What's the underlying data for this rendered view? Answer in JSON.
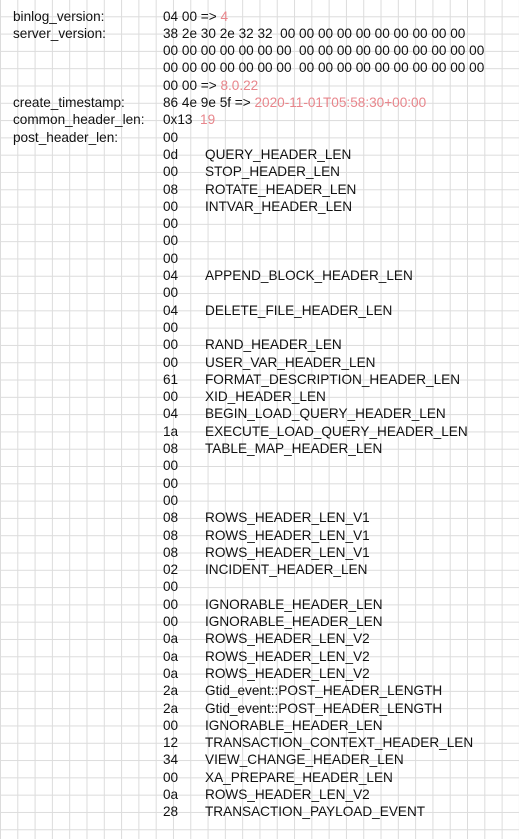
{
  "header_fields": [
    {
      "label": "binlog_version:",
      "parts": [
        {
          "text": "04 00 => "
        },
        {
          "text": "4",
          "highlight": true
        }
      ]
    },
    {
      "label": "server_version:",
      "parts": [
        {
          "text": "38 2e 30 2e 32 32  00 00 00 00 00 00 00 00 00 00"
        }
      ]
    },
    {
      "label": "",
      "parts": [
        {
          "text": "00 00 00 00 00 00 00  00 00 00 00 00 00 00 00 00 00"
        }
      ]
    },
    {
      "label": "",
      "parts": [
        {
          "text": "00 00 00 00 00 00 00  00 00 00 00 00 00 00 00 00 00"
        }
      ]
    },
    {
      "label": "",
      "parts": [
        {
          "text": "00 00 => "
        },
        {
          "text": "8.0.22",
          "highlight": true
        }
      ]
    },
    {
      "label": "create_timestamp:",
      "parts": [
        {
          "text": "86 4e 9e 5f => "
        },
        {
          "text": "2020-11-01T05:58:30+00:00",
          "highlight": true
        }
      ]
    },
    {
      "label": "common_header_len:",
      "parts": [
        {
          "text": "0x13  "
        },
        {
          "text": "19",
          "highlight": true
        }
      ]
    },
    {
      "label": "post_header_len:",
      "parts": [
        {
          "text": "00"
        }
      ]
    }
  ],
  "post_header_entries": [
    {
      "hex": "0d",
      "name": "QUERY_HEADER_LEN"
    },
    {
      "hex": "00",
      "name": "STOP_HEADER_LEN"
    },
    {
      "hex": "08",
      "name": "ROTATE_HEADER_LEN"
    },
    {
      "hex": "00",
      "name": "INTVAR_HEADER_LEN"
    },
    {
      "hex": "00",
      "name": ""
    },
    {
      "hex": "00",
      "name": ""
    },
    {
      "hex": "00",
      "name": ""
    },
    {
      "hex": "04",
      "name": "APPEND_BLOCK_HEADER_LEN"
    },
    {
      "hex": "00",
      "name": ""
    },
    {
      "hex": "04",
      "name": "DELETE_FILE_HEADER_LEN"
    },
    {
      "hex": "00",
      "name": ""
    },
    {
      "hex": "00",
      "name": "RAND_HEADER_LEN"
    },
    {
      "hex": "00",
      "name": "USER_VAR_HEADER_LEN"
    },
    {
      "hex": "61",
      "name": "FORMAT_DESCRIPTION_HEADER_LEN"
    },
    {
      "hex": "00",
      "name": "XID_HEADER_LEN"
    },
    {
      "hex": "04",
      "name": "BEGIN_LOAD_QUERY_HEADER_LEN"
    },
    {
      "hex": "1a",
      "name": "EXECUTE_LOAD_QUERY_HEADER_LEN"
    },
    {
      "hex": "08",
      "name": "TABLE_MAP_HEADER_LEN"
    },
    {
      "hex": "00",
      "name": ""
    },
    {
      "hex": "00",
      "name": ""
    },
    {
      "hex": "00",
      "name": ""
    },
    {
      "hex": "08",
      "name": "ROWS_HEADER_LEN_V1"
    },
    {
      "hex": "08",
      "name": "ROWS_HEADER_LEN_V1"
    },
    {
      "hex": "08",
      "name": "ROWS_HEADER_LEN_V1"
    },
    {
      "hex": "02",
      "name": "INCIDENT_HEADER_LEN"
    },
    {
      "hex": "00",
      "name": ""
    },
    {
      "hex": "00",
      "name": "IGNORABLE_HEADER_LEN"
    },
    {
      "hex": "00",
      "name": "IGNORABLE_HEADER_LEN"
    },
    {
      "hex": "0a",
      "name": "ROWS_HEADER_LEN_V2"
    },
    {
      "hex": "0a",
      "name": "ROWS_HEADER_LEN_V2"
    },
    {
      "hex": "0a",
      "name": "ROWS_HEADER_LEN_V2"
    },
    {
      "hex": "2a",
      "name": "Gtid_event::POST_HEADER_LENGTH"
    },
    {
      "hex": "2a",
      "name": "Gtid_event::POST_HEADER_LENGTH"
    },
    {
      "hex": "00",
      "name": "IGNORABLE_HEADER_LEN"
    },
    {
      "hex": "12",
      "name": "TRANSACTION_CONTEXT_HEADER_LEN"
    },
    {
      "hex": "34",
      "name": "VIEW_CHANGE_HEADER_LEN"
    },
    {
      "hex": "00",
      "name": "XA_PREPARE_HEADER_LEN"
    },
    {
      "hex": "0a",
      "name": "ROWS_HEADER_LEN_V2"
    },
    {
      "hex": "28",
      "name": "TRANSACTION_PAYLOAD_EVENT"
    }
  ],
  "colors": {
    "highlight": "#e8868c",
    "grid": "#dcdcdc",
    "text": "#111111"
  }
}
